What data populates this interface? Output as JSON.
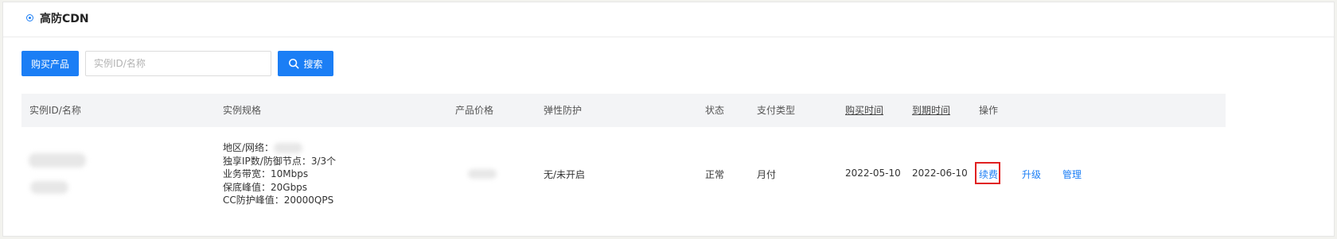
{
  "section": {
    "title": "高防CDN"
  },
  "toolbar": {
    "buy_label": "购买产品",
    "search_placeholder": "实例ID/名称",
    "search_value": "",
    "search_label": "搜索"
  },
  "table": {
    "headers": {
      "instance": "实例ID/名称",
      "spec": "实例规格",
      "price": "产品价格",
      "elastic": "弹性防护",
      "status": "状态",
      "payment": "支付类型",
      "purchase_time": "购买时间",
      "expire_time": "到期时间",
      "actions": "操作"
    },
    "rows": [
      {
        "spec": {
          "region": "地区/网络：",
          "ip_nodes": "独享IP数/防御节点：3/3个",
          "bandwidth": "业务带宽：10Mbps",
          "guarantee_peak": "保底峰值：20Gbps",
          "cc_peak": "CC防护峰值：20000QPS"
        },
        "elastic": "无/未开启",
        "status": "正常",
        "payment": "月付",
        "purchase_time": "2022-05-10",
        "expire_time": "2022-06-10",
        "actions": {
          "renew": "续费",
          "upgrade": "升级",
          "manage": "管理"
        }
      }
    ]
  },
  "colors": {
    "accent": "#1b7ef5",
    "highlight": "#e02020"
  }
}
